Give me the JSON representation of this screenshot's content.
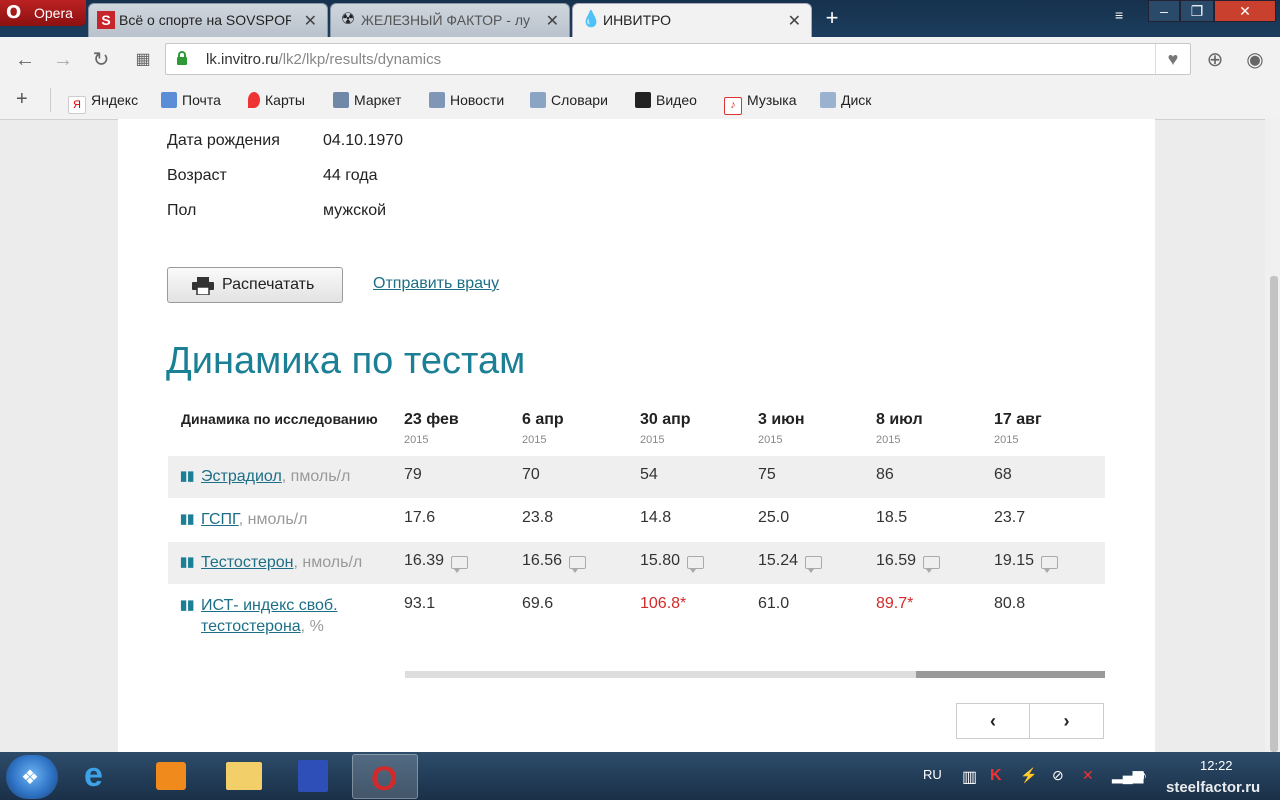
{
  "browser": {
    "menu_label": "Opera",
    "tabs": [
      {
        "label": "Всё о спорте на SOVSPOR"
      },
      {
        "label": "ЖЕЛЕЗНЫЙ ФАКТОР - лу"
      },
      {
        "label": "ИНВИТРО"
      }
    ],
    "url_host": "lk.invitro.ru",
    "url_path": "/lk2/lkp/results/dynamics",
    "bookmarks": [
      "Яндекс",
      "Почта",
      "Карты",
      "Маркет",
      "Новости",
      "Словари",
      "Видео",
      "Музыка",
      "Диск"
    ]
  },
  "patient": {
    "dob_label": "Дата рождения",
    "dob_value": "04.10.1970",
    "age_label": "Возраст",
    "age_value": "44 года",
    "sex_label": "Пол",
    "sex_value": "мужской"
  },
  "actions": {
    "print_label": "Распечатать",
    "send_label": "Отправить врачу"
  },
  "section_title": "Динамика по тестам",
  "table": {
    "corner_header": "Динамика по исследованию",
    "dates": [
      {
        "date": "23 фев",
        "year": "2015"
      },
      {
        "date": "6 апр",
        "year": "2015"
      },
      {
        "date": "30 апр",
        "year": "2015"
      },
      {
        "date": "3 июн",
        "year": "2015"
      },
      {
        "date": "8 июл",
        "year": "2015"
      },
      {
        "date": "17 авг",
        "year": "2015"
      }
    ],
    "rows": [
      {
        "name": "Эстрадиол",
        "unit": ", пмоль/л",
        "values": [
          "79",
          "70",
          "54",
          "75",
          "86",
          "68"
        ]
      },
      {
        "name": "ГСПГ",
        "unit": ", нмоль/л",
        "values": [
          "17.6",
          "23.8",
          "14.8",
          "25.0",
          "18.5",
          "23.7"
        ]
      },
      {
        "name": "Тестостерон",
        "unit": ", нмоль/л",
        "values": [
          "16.39",
          "16.56",
          "15.80",
          "15.24",
          "16.59",
          "19.15"
        ]
      },
      {
        "name_line1": "ИСТ- индекс своб.",
        "name_line2": "тестостерона",
        "unit": ", %",
        "values": [
          "93.1",
          "69.6",
          "106.8*",
          "61.0",
          "89.7*",
          "80.8"
        ]
      }
    ]
  },
  "pager": {
    "prev": "‹",
    "next": "›"
  },
  "taskbar": {
    "lang": "RU",
    "time": "12:22"
  },
  "watermark": "steelfactor.ru",
  "colors": {
    "accent": "#1b7f96",
    "link": "#1c6f86",
    "flag_red": "#d32a2a"
  }
}
